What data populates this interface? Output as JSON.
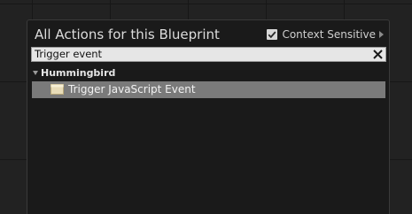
{
  "header": {
    "title": "All Actions for this Blueprint",
    "context_sensitive_label": "Context Sensitive",
    "context_sensitive_checked": true
  },
  "search": {
    "value": "Trigger event",
    "clear_icon": "close-icon"
  },
  "tree": {
    "category": "Hummingbird",
    "items": [
      {
        "label": "Trigger JavaScript Event",
        "icon": "function-node-icon",
        "selected": true
      }
    ]
  },
  "colors": {
    "background": "#222222",
    "panel": "#1a1a1a",
    "selection": "#7a7a7a",
    "search_field": "#e6e6e6"
  }
}
